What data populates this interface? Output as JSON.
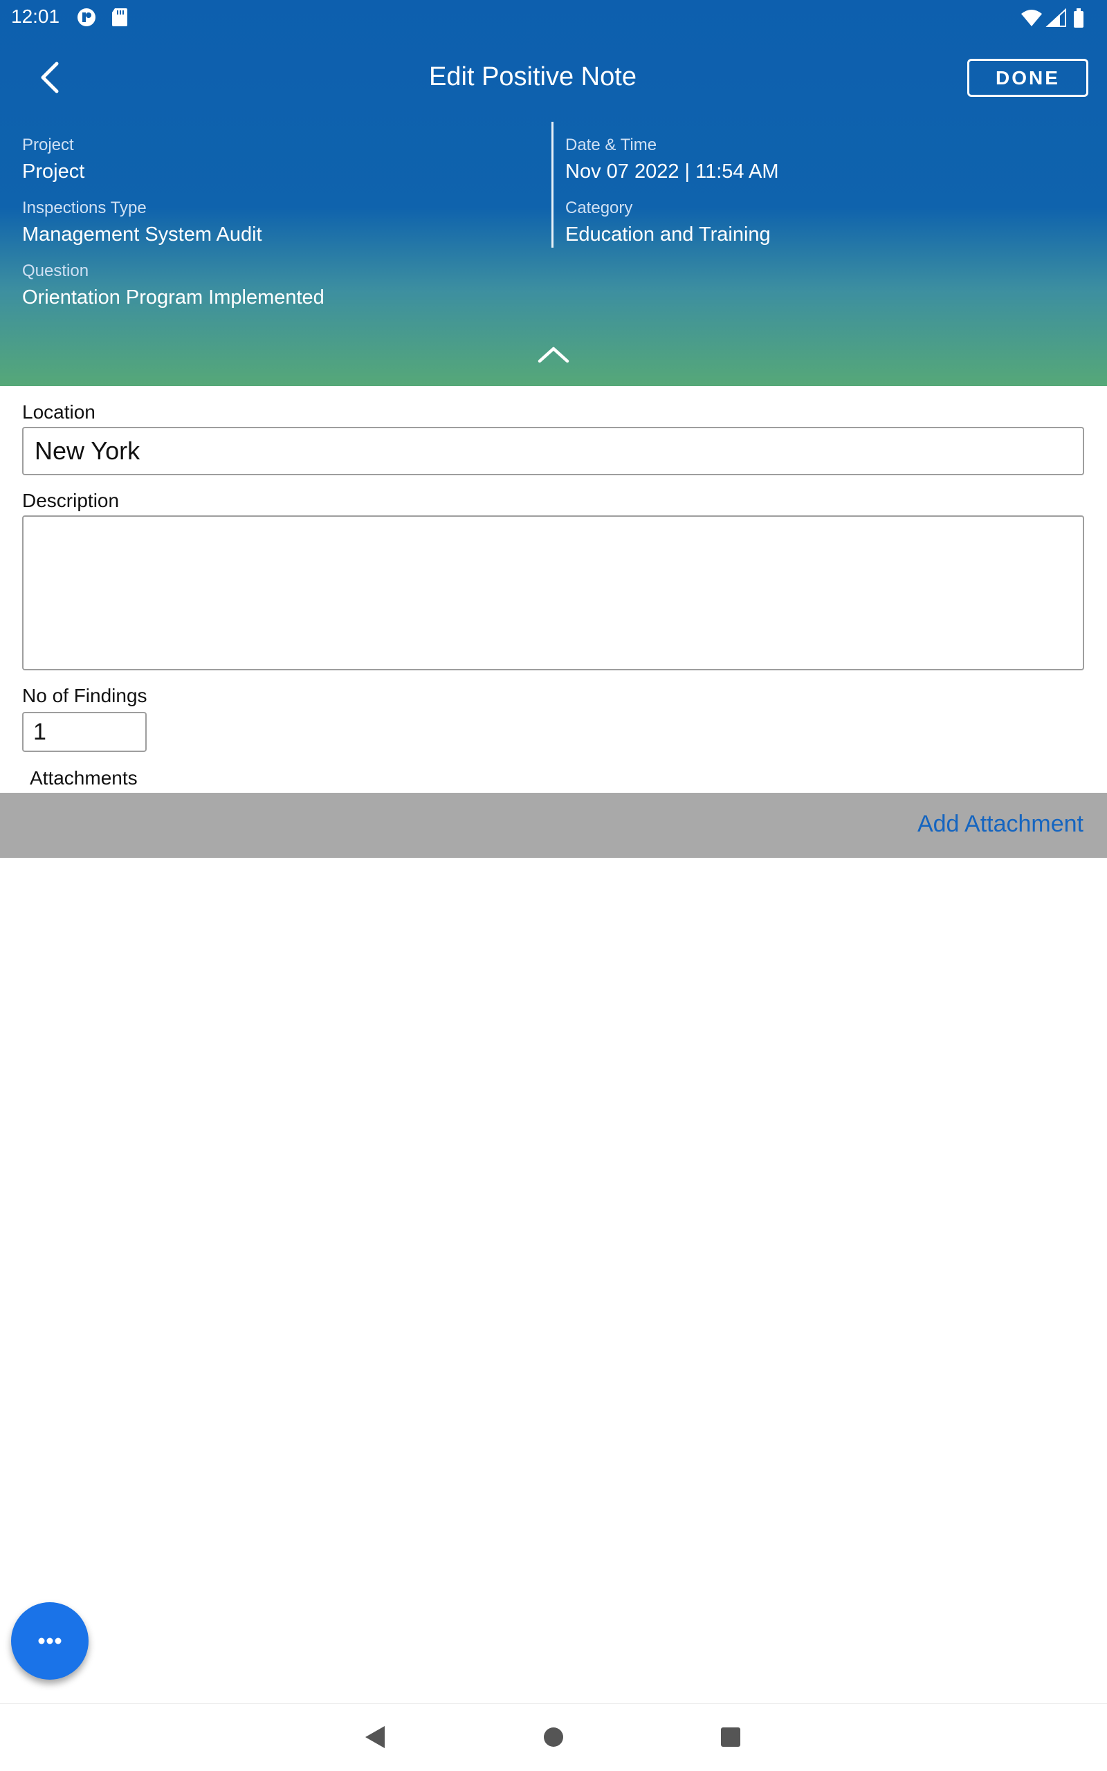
{
  "status_bar": {
    "time": "12:01"
  },
  "header": {
    "title": "Edit Positive Note",
    "done_label": "DONE",
    "colors": {
      "top": "#0d5fae",
      "bottom": "#56a878"
    }
  },
  "info": {
    "project_label": "Project",
    "project_value": "Project",
    "inspection_type_label": "Inspections Type",
    "inspection_type_value": "Management System Audit",
    "question_label": "Question",
    "question_value": "Orientation Program Implemented",
    "datetime_label": "Date & Time",
    "datetime_value": "Nov 07 2022 | 11:54 AM",
    "category_label": "Category",
    "category_value": "Education and Training"
  },
  "form": {
    "location_label": "Location",
    "location_value": "New York",
    "description_label": "Description",
    "description_value": "",
    "findings_label": "No of Findings",
    "findings_value": "1",
    "attachments_label": "Attachments",
    "add_attachment_label": "Add Attachment"
  },
  "icons": {
    "back": "chevron-left-icon",
    "collapse": "chevron-up-icon",
    "fab": "more-horizontal-icon",
    "nav_back": "triangle-back-icon",
    "nav_home": "circle-home-icon",
    "nav_recents": "square-recents-icon"
  },
  "accent_color": "#1a73e8"
}
